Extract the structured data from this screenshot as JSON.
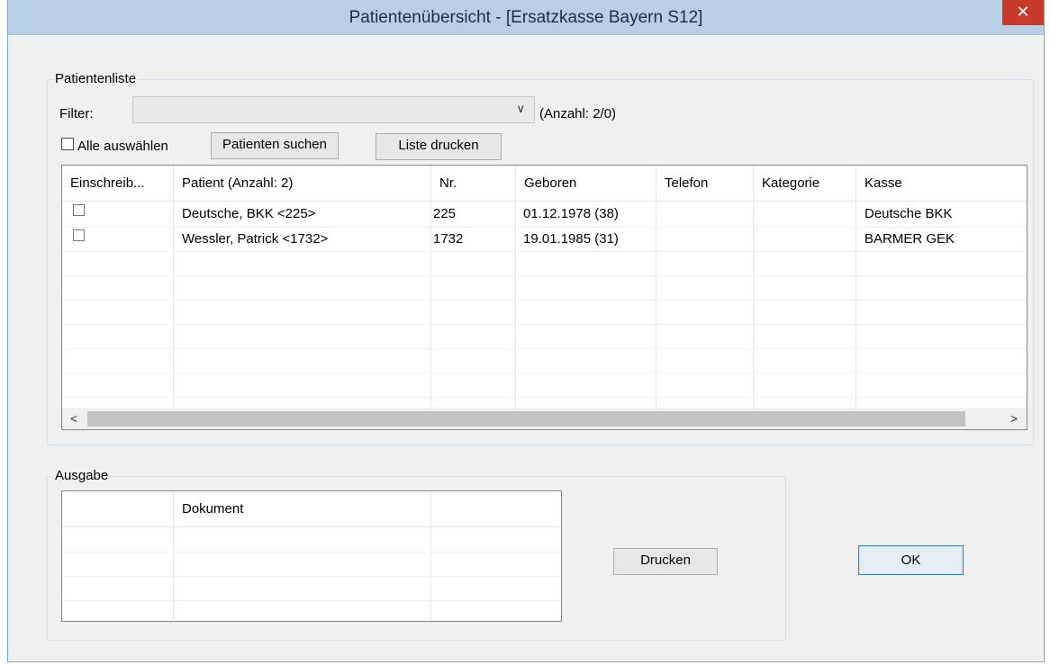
{
  "window": {
    "title": "Patientenübersicht - [Ersatzkasse Bayern S12]",
    "close_glyph": "✕"
  },
  "patientenliste": {
    "group_label": "Patientenliste",
    "filter_label": "Filter:",
    "filter_value": "",
    "count_text": "(Anzahl: 2/0)",
    "select_all_label": "Alle auswählen",
    "search_button": "Patienten suchen",
    "print_list_button": "Liste drucken",
    "columns": [
      "Einschreib...",
      "Patient (Anzahl: 2)",
      "Nr.",
      "Geboren",
      "Telefon",
      "Kategorie",
      "Kasse"
    ],
    "rows": [
      {
        "patient": "Deutsche,  BKK <225>",
        "nr": "225",
        "geboren": "01.12.1978 (38)",
        "telefon": "",
        "kategorie": "",
        "kasse": "Deutsche BKK"
      },
      {
        "patient": "Wessler,  Patrick <1732>",
        "nr": "1732",
        "geboren": "19.01.1985 (31)",
        "telefon": "",
        "kategorie": "",
        "kasse": "BARMER GEK"
      }
    ],
    "scroll_left": "<",
    "scroll_right": ">"
  },
  "ausgabe": {
    "group_label": "Ausgabe",
    "columns": [
      "",
      "Dokument",
      ""
    ],
    "print_button": "Drucken"
  },
  "ok_button": "OK",
  "colors": {
    "titlebar": "#b9cfe6",
    "close": "#c7392b",
    "dialog_bg": "#f0f0f0"
  }
}
